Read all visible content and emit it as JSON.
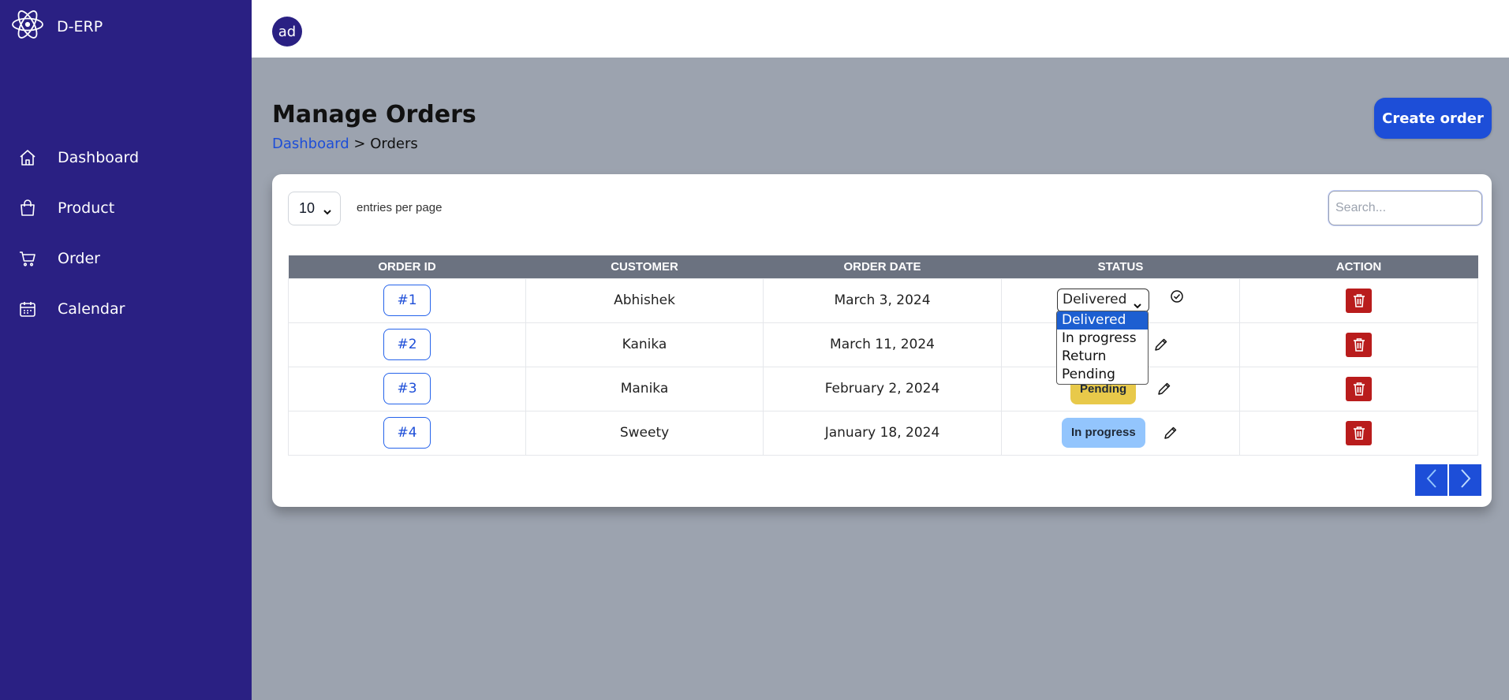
{
  "app": {
    "brand": "D-ERP",
    "avatar": "ad",
    "icon": "atom-icon"
  },
  "sidebar": {
    "items": [
      {
        "label": "Dashboard",
        "icon": "home-icon"
      },
      {
        "label": "Product",
        "icon": "bag-icon"
      },
      {
        "label": "Order",
        "icon": "cart-icon"
      },
      {
        "label": "Calendar",
        "icon": "calendar-icon"
      }
    ]
  },
  "page": {
    "title": "Manage Orders",
    "breadcrumb_link": "Dashboard",
    "breadcrumb_sep": ">",
    "breadcrumb_current": "Orders",
    "create_label": "Create order"
  },
  "table_controls": {
    "per_page_value": "10",
    "per_page_label": "entries per page",
    "search_placeholder": "Search..."
  },
  "table": {
    "headers": [
      "ORDER ID",
      "CUSTOMER",
      "ORDER DATE",
      "STATUS",
      "ACTION"
    ],
    "rows": [
      {
        "id": "#1",
        "customer": "Abhishek",
        "date": "March 3, 2024",
        "status": "Delivered",
        "editing": true
      },
      {
        "id": "#2",
        "customer": "Kanika",
        "date": "March 11, 2024",
        "status": "",
        "editing": false
      },
      {
        "id": "#3",
        "customer": "Manika",
        "date": "February 2, 2024",
        "status": "Pending",
        "editing": false
      },
      {
        "id": "#4",
        "customer": "Sweety",
        "date": "January 18, 2024",
        "status": "In progress",
        "editing": false
      }
    ]
  },
  "status_dropdown": {
    "options": [
      "Delivered",
      "In progress",
      "Return",
      "Pending"
    ],
    "selected": "Delivered"
  },
  "colors": {
    "sidebar": "#2a2083",
    "primary": "#1d4ed8",
    "pending": "#e8c94a",
    "in_progress": "#93c5fd",
    "danger": "#b91c1c"
  }
}
